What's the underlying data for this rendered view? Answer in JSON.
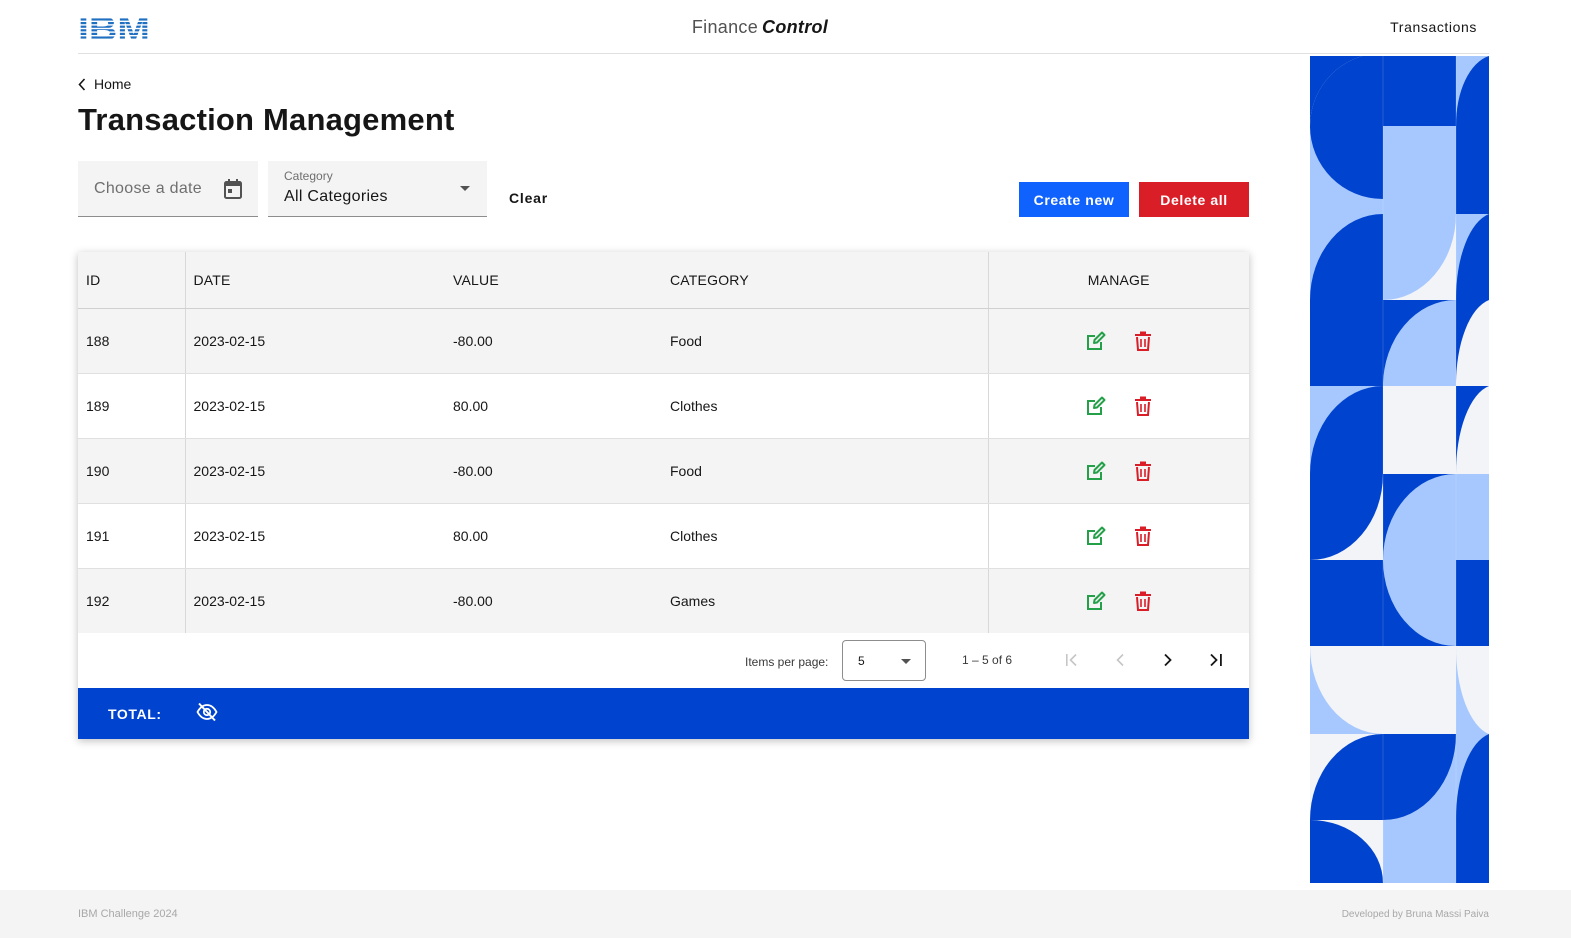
{
  "header": {
    "logo_text": "IBM",
    "app_title_main": "Finance",
    "app_title_accent": "Control",
    "nav_link": "Transactions"
  },
  "breadcrumb": {
    "label": "Home"
  },
  "page_title": "Transaction Management",
  "filters": {
    "date_placeholder": "Choose a date",
    "category_label": "Category",
    "category_value": "All Categories",
    "clear_label": "Clear"
  },
  "actions": {
    "create_label": "Create new",
    "delete_all_label": "Delete all"
  },
  "table": {
    "columns": [
      "ID",
      "DATE",
      "VALUE",
      "CATEGORY",
      "MANAGE"
    ],
    "rows": [
      {
        "id": "188",
        "date": "2023-02-15",
        "value": "-80.00",
        "category": "Food"
      },
      {
        "id": "189",
        "date": "2023-02-15",
        "value": "80.00",
        "category": "Clothes"
      },
      {
        "id": "190",
        "date": "2023-02-15",
        "value": "-80.00",
        "category": "Food"
      },
      {
        "id": "191",
        "date": "2023-02-15",
        "value": "80.00",
        "category": "Clothes"
      },
      {
        "id": "192",
        "date": "2023-02-15",
        "value": "-80.00",
        "category": "Games"
      }
    ]
  },
  "paginator": {
    "items_per_page_label": "Items per page:",
    "page_size": "5",
    "range": "1 – 5 of 6"
  },
  "total": {
    "label": "TOTAL:"
  },
  "footer": {
    "left": "IBM Challenge 2024",
    "right": "Developed by Bruna Massi Paiva"
  },
  "colors": {
    "primary": "#0f62fe",
    "danger": "#da1e28",
    "total_bar": "#0043ce",
    "edit_icon": "#24a148",
    "delete_icon": "#da1e28"
  },
  "icons": {
    "back": "chevron-left-icon",
    "calendar": "calendar-icon",
    "edit": "edit-icon",
    "delete": "trash-icon",
    "visibility": "eye-off-icon"
  }
}
